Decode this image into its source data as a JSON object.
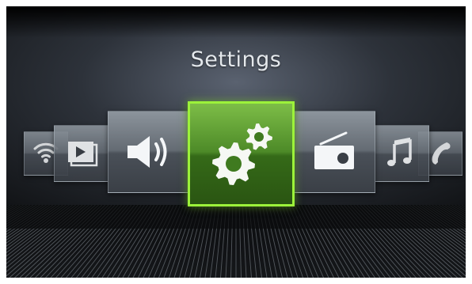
{
  "screen": {
    "title": "Settings"
  },
  "menu": {
    "items": [
      {
        "id": "connectivity",
        "icon": "wifi-icon"
      },
      {
        "id": "media",
        "icon": "media-player-icon"
      },
      {
        "id": "sound",
        "icon": "speaker-icon"
      },
      {
        "id": "settings",
        "icon": "gears-icon",
        "selected": true
      },
      {
        "id": "radio",
        "icon": "radio-icon"
      },
      {
        "id": "music",
        "icon": "music-note-icon"
      },
      {
        "id": "phone",
        "icon": "phone-icon"
      }
    ]
  },
  "colors": {
    "selected_border": "#9cf23a",
    "selected_fill": "#4d8a28",
    "tile_fill": "#646b73",
    "title_text": "#e4e8ec"
  }
}
